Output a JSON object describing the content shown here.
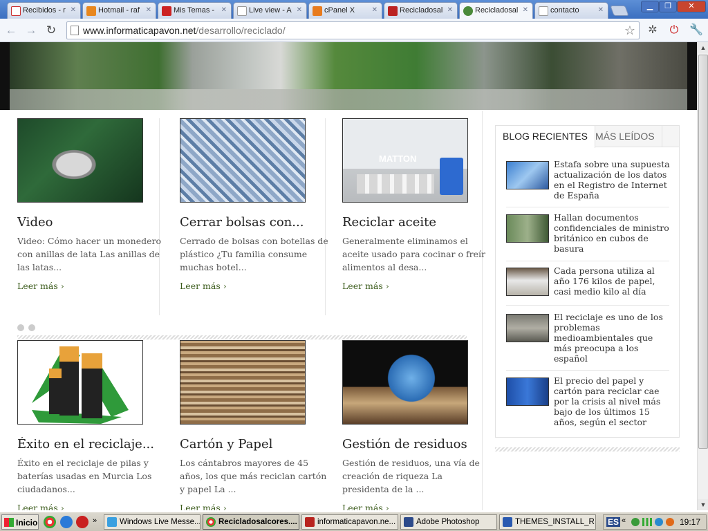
{
  "browser": {
    "tabs": [
      {
        "label": "Recibidos - r",
        "color": "#c33"
      },
      {
        "label": "Hotmail - raf",
        "color": "#e8871e"
      },
      {
        "label": "Mis Temas -",
        "color": "#c22"
      },
      {
        "label": "Live view - A",
        "color": "#999"
      },
      {
        "label": "cPanel X",
        "color": "#e87b1e"
      },
      {
        "label": "Recicladosal",
        "color": "#b22"
      },
      {
        "label": "Recicladosal",
        "color": "#4a8a3a"
      },
      {
        "label": "contacto",
        "color": "#999"
      }
    ],
    "url_domain": "www.informaticapavon.net",
    "url_path": "/desarrollo/reciclado/"
  },
  "articles": [
    {
      "title": "Video",
      "excerpt": "Video: Cómo hacer un monedero con anillas de lata Las anillas de las latas...",
      "more": "Leer más ›"
    },
    {
      "title": "Cerrar bolsas con...",
      "excerpt": "Cerrado de bolsas con botellas de plástico ¿Tu familia consume muchas botel...",
      "more": "Leer más ›"
    },
    {
      "title": "Reciclar aceite",
      "excerpt": "Generalmente eliminamos el aceite usado para cocinar o freír alimentos al desa...",
      "more": "Leer más ›"
    },
    {
      "title": "Éxito en el reciclaje...",
      "excerpt": "Éxito en el reciclaje de pilas y baterías usadas en Murcia Los ciudadanos...",
      "more": "Leer más ›"
    },
    {
      "title": "Cartón y Papel",
      "excerpt": "Los cántabros mayores de 45 años, los que más reciclan cartón y papel La ...",
      "more": "Leer más ›"
    },
    {
      "title": "Gestión de residuos",
      "excerpt": "Gestión de residuos, una vía de creación de riqueza La presidenta de la ...",
      "more": "Leer más ›"
    }
  ],
  "image_text": {
    "matton": "MATTON"
  },
  "sidebar": {
    "tab_recent": "BLOG RECIENTES",
    "tab_popular": "MÁS LEÍDOS",
    "posts": [
      {
        "title": "Estafa sobre una supuesta actualización de los datos en el Registro de Internet de España"
      },
      {
        "title": "Hallan documentos confidenciales de ministro británico en cubos de basura"
      },
      {
        "title": "Cada persona utiliza al año 176 kilos de papel, casi medio kilo al día"
      },
      {
        "title": "El reciclaje es uno de los problemas medioambientales que más preocupa a los español"
      },
      {
        "title": "El precio del papel y cartón para reciclar cae por la crisis al nivel más bajo de los últimos 15 años, según el sector"
      }
    ]
  },
  "taskbar": {
    "start": "Inicio",
    "tasks": [
      "Windows Live Messe...",
      "Recicladosalcores....",
      "informaticapavon.ne...",
      "Adobe Photoshop",
      "THEMES_INSTALL_R..."
    ],
    "lang": "ES",
    "time": "19:17"
  }
}
